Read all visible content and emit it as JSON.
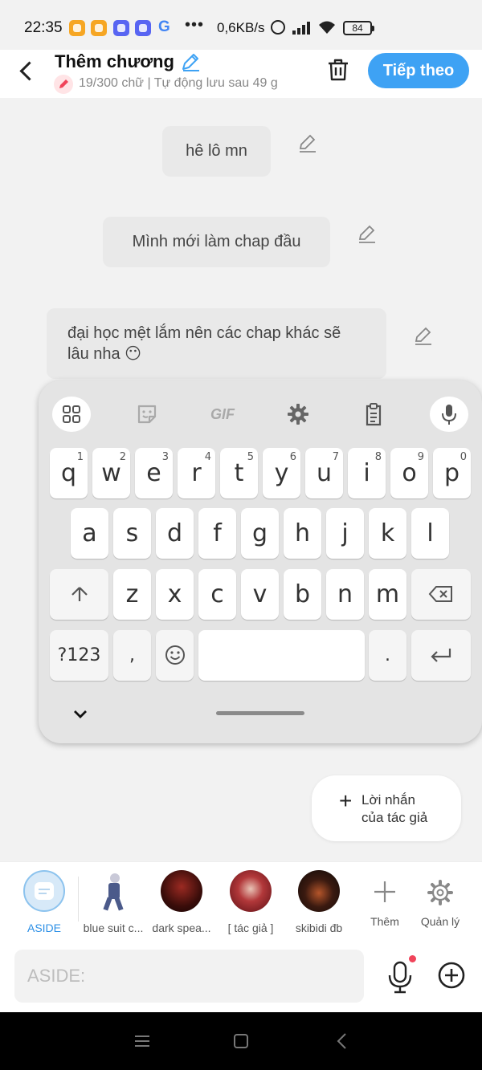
{
  "status_bar": {
    "time": "22:35",
    "more": "•••",
    "net_speed": "0,6KB/s",
    "battery": "84",
    "google_glyph": "G",
    "icons": [
      "orange-app-icon",
      "orange-app-icon",
      "discord-icon",
      "discord-icon",
      "google-icon",
      "alarm-icon",
      "signal-icon",
      "wifi-icon",
      "battery-icon"
    ]
  },
  "header": {
    "title": "Thêm chương",
    "subtitle": "19/300 chữ | Tự động lưu sau 49 g",
    "next_label": "Tiếp theo",
    "accent_color": "#3ea2f4"
  },
  "messages": [
    {
      "text": "hê lô mn"
    },
    {
      "text": "Mình mới làm chap đầu"
    },
    {
      "text": "đại học mệt lắm nên các chap khác sẽ lâu nha 😶"
    }
  ],
  "keyboard": {
    "toolbar": [
      "apps-grid-icon",
      "sticker-icon",
      "gif-icon",
      "settings-gear-icon",
      "clipboard-icon",
      "microphone-icon"
    ],
    "gif_label": "GIF",
    "row1": [
      {
        "k": "q",
        "n": "1"
      },
      {
        "k": "w",
        "n": "2"
      },
      {
        "k": "e",
        "n": "3"
      },
      {
        "k": "r",
        "n": "4"
      },
      {
        "k": "t",
        "n": "5"
      },
      {
        "k": "y",
        "n": "6"
      },
      {
        "k": "u",
        "n": "7"
      },
      {
        "k": "i",
        "n": "8"
      },
      {
        "k": "o",
        "n": "9"
      },
      {
        "k": "p",
        "n": "0"
      }
    ],
    "row2": [
      "a",
      "s",
      "d",
      "f",
      "g",
      "h",
      "j",
      "k",
      "l"
    ],
    "row3": [
      "z",
      "x",
      "c",
      "v",
      "b",
      "n",
      "m"
    ],
    "symbols_label": "?123",
    "comma": ",",
    "period": "."
  },
  "author_note": {
    "plus": "+",
    "line1": "Lời nhắn",
    "line2": "của tác giả"
  },
  "characters": [
    {
      "label": "ASIDE",
      "active": true
    },
    {
      "label": "blue suit c..."
    },
    {
      "label": "dark spea..."
    },
    {
      "label": "[ tác giả ]"
    },
    {
      "label": "skibidi đb"
    },
    {
      "label": "Thêm"
    },
    {
      "label": "Quản lý"
    }
  ],
  "input": {
    "placeholder": "ASIDE:"
  }
}
